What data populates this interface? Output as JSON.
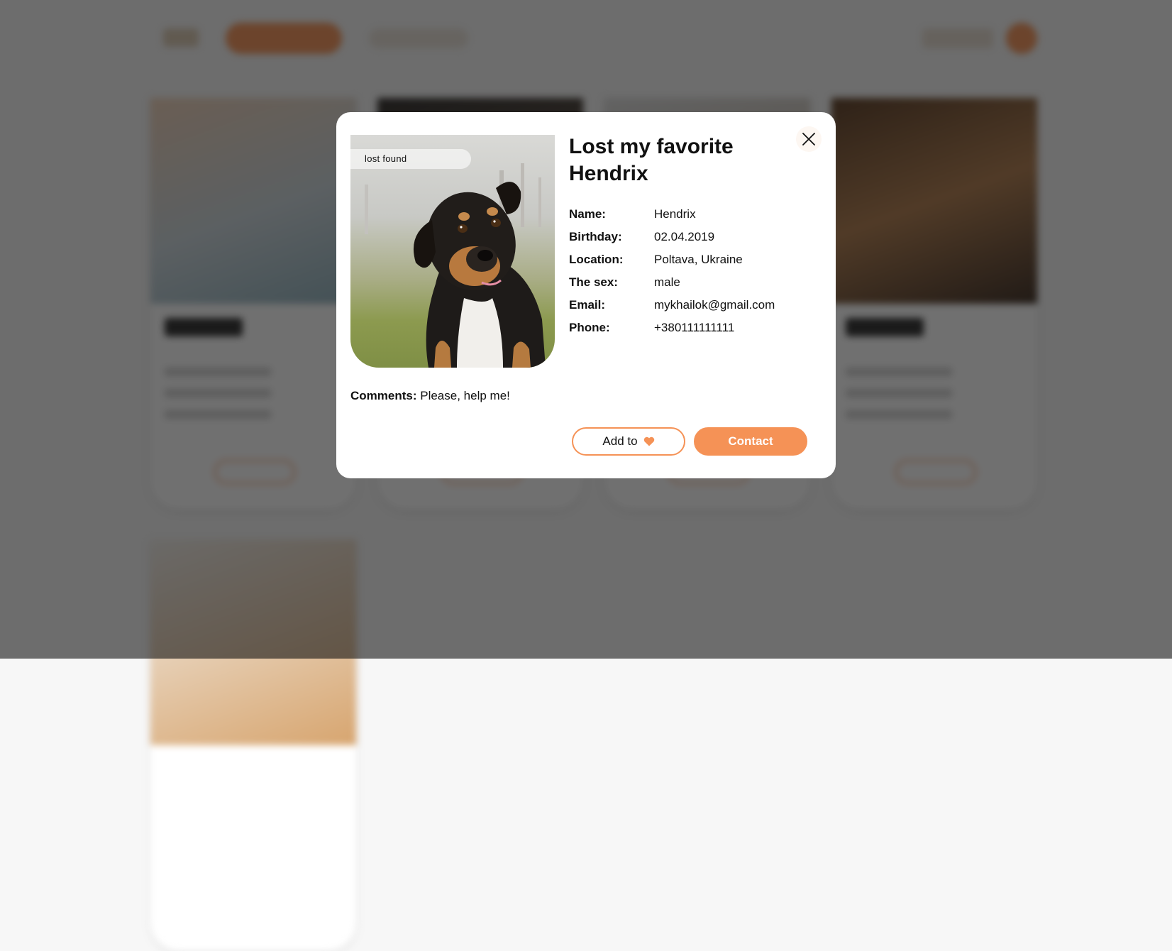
{
  "modal": {
    "badge": "lost found",
    "title": "Lost my favorite Hendrix",
    "details": [
      {
        "label": "Name:",
        "value": "Hendrix"
      },
      {
        "label": "Birthday:",
        "value": "02.04.2019"
      },
      {
        "label": "Location:",
        "value": "Poltava, Ukraine"
      },
      {
        "label": "The sex:",
        "value": "male"
      },
      {
        "label": "Email:",
        "value": "mykhailok@gmail.com"
      },
      {
        "label": "Phone:",
        "value": "+380111111111"
      }
    ],
    "comments_label": "Comments:",
    "comments_text": " Please, help me!",
    "add_button_label": "Add to",
    "contact_button_label": "Contact",
    "icons": {
      "close": "close-icon",
      "heart": "heart-icon"
    }
  },
  "colors": {
    "accent": "#f59256",
    "overlay": "rgba(17,17,17,0.6)",
    "modal_bg": "#ffffff",
    "close_bg": "#fdf7f2"
  }
}
